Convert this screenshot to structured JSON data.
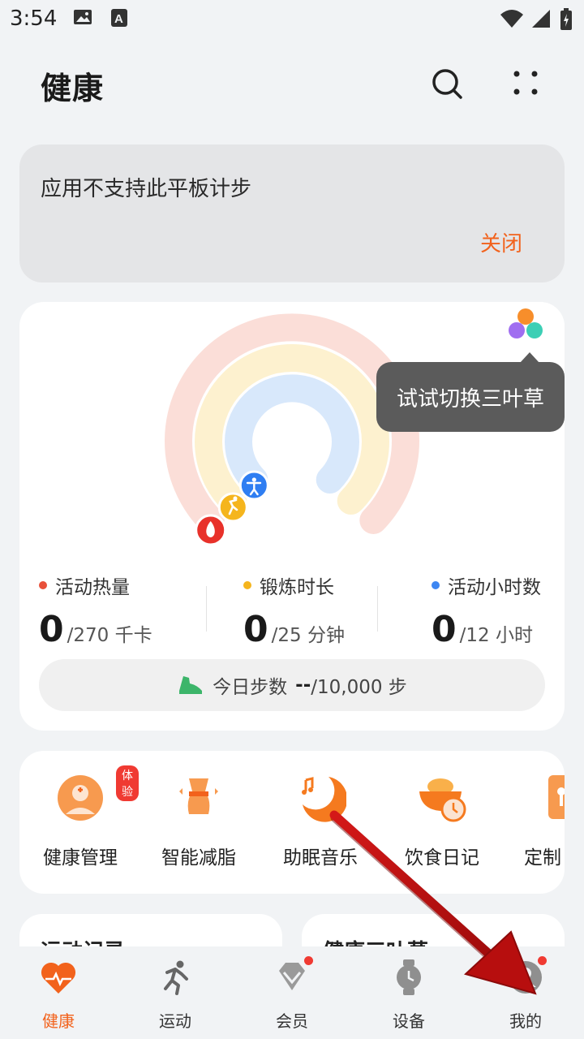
{
  "status_bar": {
    "time": "3:54"
  },
  "header": {
    "title": "健康"
  },
  "notice": {
    "text": "应用不支持此平板计步",
    "close_label": "关闭"
  },
  "activity": {
    "tooltip": "试试切换三叶草",
    "stats": [
      {
        "label": "活动热量",
        "value": "0",
        "goal": "/270 千卡",
        "color": "#e8503a"
      },
      {
        "label": "锻炼时长",
        "value": "0",
        "goal": "/25 分钟",
        "color": "#f5b51d"
      },
      {
        "label": "活动小时数",
        "value": "0",
        "goal": "/12 小时",
        "color": "#3d86f2"
      }
    ],
    "steps": {
      "label": "今日步数",
      "value": "--",
      "goal": "/10,000 步"
    }
  },
  "shortcuts": {
    "trial_badge": "体验",
    "items": [
      {
        "label": "健康管理"
      },
      {
        "label": "智能减脂"
      },
      {
        "label": "助眠音乐"
      },
      {
        "label": "饮食日记"
      },
      {
        "label": "定制"
      }
    ]
  },
  "cards": [
    {
      "title": "运动记录"
    },
    {
      "title": "健康三叶草"
    }
  ],
  "nav": {
    "items": [
      {
        "label": "健康"
      },
      {
        "label": "运动"
      },
      {
        "label": "会员"
      },
      {
        "label": "设备"
      },
      {
        "label": "我的"
      }
    ]
  },
  "colors": {
    "accent": "#f2621c",
    "calorie": "#e8503a",
    "exercise": "#f5b51d",
    "hours": "#3d86f2"
  }
}
